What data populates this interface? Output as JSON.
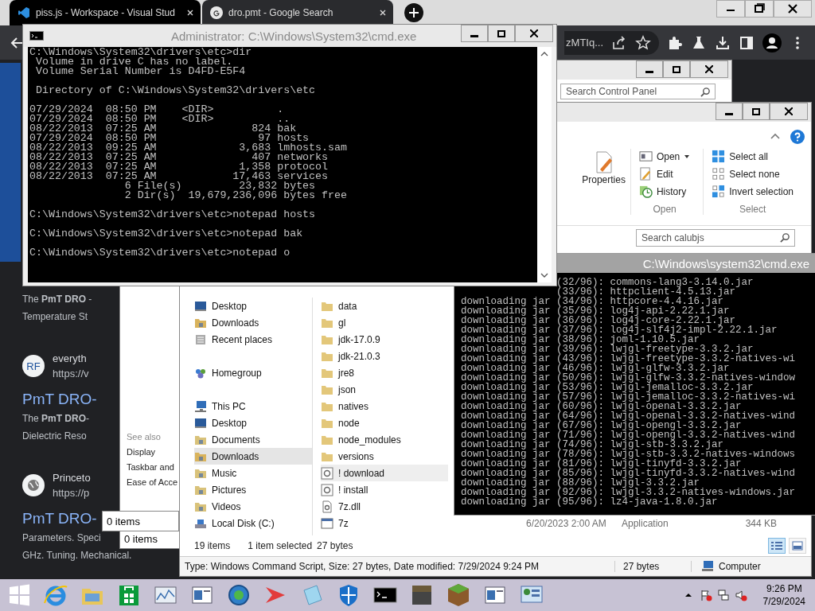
{
  "browser": {
    "tabs": [
      {
        "title": "piss.js - Workspace - Visual Stud",
        "kind": "code",
        "selected": false
      },
      {
        "title": "dro.pmt - Google Search",
        "kind": "google",
        "selected": true
      }
    ],
    "address_fragment": "zMTIq...",
    "results": [
      {
        "kind": "snippet",
        "text": "The **PmT DRO** -"
      },
      {
        "kind": "snippet",
        "text": "Temperature St"
      },
      {
        "kind": "source",
        "avatar": "RF",
        "name": "everyth",
        "url": "https://v"
      },
      {
        "kind": "title",
        "text": "PmT DRO-"
      },
      {
        "kind": "snippet",
        "text": "The **PmT DRO**-"
      },
      {
        "kind": "snippet",
        "text": "Dielectric Reso"
      },
      {
        "kind": "source",
        "name": "Princeto",
        "url": "https://p"
      },
      {
        "kind": "title",
        "text": "PmT DRO-"
      },
      {
        "kind": "snippet",
        "text": "Parameters. Speci"
      },
      {
        "kind": "snippet",
        "text": "GHz. Tuning. Mechanical."
      }
    ]
  },
  "control_panel": {
    "search": {
      "placeholder": "Search Control Panel"
    },
    "see_also_heading": "See also",
    "see_also": [
      "Display",
      "Taskbar and",
      "Ease of Acce"
    ],
    "status": "0 items"
  },
  "back_window": {
    "status": "0 items"
  },
  "explorer": {
    "properties": "Properties",
    "ribbon_groups": [
      {
        "label": "Open",
        "buttons": [
          {
            "label": "Open",
            "kind": "open",
            "menu": true
          },
          {
            "label": "Edit",
            "kind": "edit",
            "menu": false
          },
          {
            "label": "History",
            "kind": "history",
            "menu": false
          }
        ]
      },
      {
        "label": "Select",
        "buttons": [
          {
            "label": "Select all",
            "kind": "select-all",
            "menu": false
          },
          {
            "label": "Select none",
            "kind": "select-none",
            "menu": false
          },
          {
            "label": "Invert selection",
            "kind": "invert",
            "menu": false
          }
        ]
      }
    ],
    "search": {
      "placeholder": "Search calubjs"
    },
    "nav_pane": [
      {
        "children": [
          {
            "label": "Desktop",
            "kind": "desktop",
            "selected": false
          },
          {
            "label": "Downloads",
            "kind": "downloads",
            "selected": false
          },
          {
            "label": "Recent places",
            "kind": "recent",
            "selected": false
          }
        ]
      },
      {
        "label": "Homegroup",
        "kind": "homegroup",
        "selected": false
      },
      {
        "label": "This PC",
        "kind": "pc",
        "selected": false,
        "children": [
          {
            "label": "Desktop",
            "kind": "desktop",
            "selected": false
          },
          {
            "label": "Documents",
            "kind": "documents",
            "selected": false
          },
          {
            "label": "Downloads",
            "kind": "downloads",
            "selected": true
          },
          {
            "label": "Music",
            "kind": "music",
            "selected": false
          },
          {
            "label": "Pictures",
            "kind": "pictures",
            "selected": false
          },
          {
            "label": "Videos",
            "kind": "videos",
            "selected": false
          },
          {
            "label": "Local Disk (C:)",
            "kind": "disk",
            "selected": false
          }
        ]
      }
    ],
    "files": [
      {
        "name": "data",
        "kind": "folder",
        "selected": false
      },
      {
        "name": "gl",
        "kind": "folder",
        "selected": false
      },
      {
        "name": "jdk-17.0.9",
        "kind": "folder",
        "selected": false
      },
      {
        "name": "jdk-21.0.3",
        "kind": "folder",
        "selected": false
      },
      {
        "name": "jre8",
        "kind": "folder",
        "selected": false
      },
      {
        "name": "json",
        "kind": "folder",
        "selected": false
      },
      {
        "name": "natives",
        "kind": "folder",
        "selected": false
      },
      {
        "name": "node",
        "kind": "folder",
        "selected": false
      },
      {
        "name": "node_modules",
        "kind": "folder",
        "selected": false
      },
      {
        "name": "versions",
        "kind": "folder",
        "selected": false
      },
      {
        "name": "! download",
        "kind": "script",
        "selected": true
      },
      {
        "name": "! install",
        "kind": "script",
        "selected": false
      },
      {
        "name": "7z.dll",
        "kind": "dll",
        "selected": false
      },
      {
        "name": "7z",
        "kind": "app",
        "selected": false,
        "date": "6/20/2023 2:00 AM",
        "type": "Application",
        "size": "344 KB"
      }
    ],
    "status": {
      "count": "19 items",
      "selection": "1 item selected",
      "size": "27 bytes"
    },
    "views": [
      {
        "kind": "details",
        "selected": true
      },
      {
        "kind": "large",
        "selected": false
      }
    ],
    "details_bar": {
      "info": "Type: Windows Command Script, Size: 27 bytes, Date modified: 7/29/2024 9:24 PM",
      "size": "27 bytes",
      "location": "Computer"
    }
  },
  "cmd_right": {
    "title": "C:\\Windows\\system32\\cmd.exe",
    "lines": [
      "                (32/96): commons-lang3-3.14.0.jar",
      "                (33/96): httpclient-4.5.13.jar",
      "downloading jar (34/96): httpcore-4.4.16.jar",
      "downloading jar (35/96): log4j-api-2.22.1.jar",
      "downloading jar (36/96): log4j-core-2.22.1.jar",
      "downloading jar (37/96): log4j-slf4j2-impl-2.22.1.jar",
      "downloading jar (38/96): joml-1.10.5.jar",
      "downloading jar (39/96): lwjgl-freetype-3.3.2.jar",
      "downloading jar (43/96): lwjgl-freetype-3.3.2-natives-wi",
      "downloading jar (46/96): lwjgl-glfw-3.3.2.jar",
      "downloading jar (50/96): lwjgl-glfw-3.3.2-natives-window",
      "downloading jar (53/96): lwjgl-jemalloc-3.3.2.jar",
      "downloading jar (57/96): lwjgl-jemalloc-3.3.2-natives-wi",
      "downloading jar (60/96): lwjgl-openal-3.3.2.jar",
      "downloading jar (64/96): lwjgl-openal-3.3.2-natives-wind",
      "downloading jar (67/96): lwjgl-opengl-3.3.2.jar",
      "downloading jar (71/96): lwjgl-opengl-3.3.2-natives-wind",
      "downloading jar (74/96): lwjgl-stb-3.3.2.jar",
      "downloading jar (78/96): lwjgl-stb-3.3.2-natives-windows",
      "downloading jar (81/96): lwjgl-tinyfd-3.3.2.jar",
      "downloading jar (85/96): lwjgl-tinyfd-3.3.2-natives-wind",
      "downloading jar (88/96): lwjgl-3.3.2.jar",
      "downloading jar (92/96): lwjgl-3.3.2-natives-windows.jar",
      "downloading jar (95/96): lz4-java-1.8.0.jar"
    ]
  },
  "cmd_admin": {
    "title": "Administrator: C:\\Windows\\System32\\cmd.exe",
    "blocks": [
      [
        "C:\\Windows\\System32\\drivers\\etc>dir",
        " Volume in drive C has no label.",
        " Volume Serial Number is D4FD-E5F4"
      ],
      [
        " Directory of C:\\Windows\\System32\\drivers\\etc"
      ],
      [
        "07/29/2024  08:50 PM    <DIR>          .",
        "07/29/2024  08:50 PM    <DIR>          ..",
        "08/22/2013  07:25 AM               824 bak",
        "07/29/2024  08:50 PM                97 hosts",
        "08/22/2013  09:25 AM             3,683 lmhosts.sam",
        "08/22/2013  07:25 AM               407 networks",
        "08/22/2013  07:25 AM             1,358 protocol",
        "08/22/2013  07:25 AM            17,463 services",
        "               6 File(s)         23,832 bytes",
        "               2 Dir(s)  19,679,236,096 bytes free"
      ],
      [
        "C:\\Windows\\System32\\drivers\\etc>notepad hosts"
      ],
      [
        "C:\\Windows\\System32\\drivers\\etc>notepad bak"
      ],
      [
        "C:\\Windows\\System32\\drivers\\etc>notepad o"
      ]
    ]
  },
  "taskbar": {
    "apps": [
      {
        "kind": "start"
      },
      {
        "kind": "ie"
      },
      {
        "kind": "files"
      },
      {
        "kind": "store"
      },
      {
        "kind": "monitor"
      },
      {
        "kind": "window"
      },
      {
        "kind": "globe"
      },
      {
        "kind": "arrow"
      },
      {
        "kind": "notepad"
      },
      {
        "kind": "shield"
      },
      {
        "kind": "cmd"
      },
      {
        "kind": "block-dark"
      },
      {
        "kind": "block-grass"
      },
      {
        "kind": "window"
      },
      {
        "kind": "panel"
      }
    ],
    "tray": [
      {
        "kind": "caret"
      },
      {
        "kind": "flag"
      },
      {
        "kind": "network"
      },
      {
        "kind": "speaker"
      }
    ],
    "time": "9:26 PM",
    "date": "7/29/2024"
  }
}
